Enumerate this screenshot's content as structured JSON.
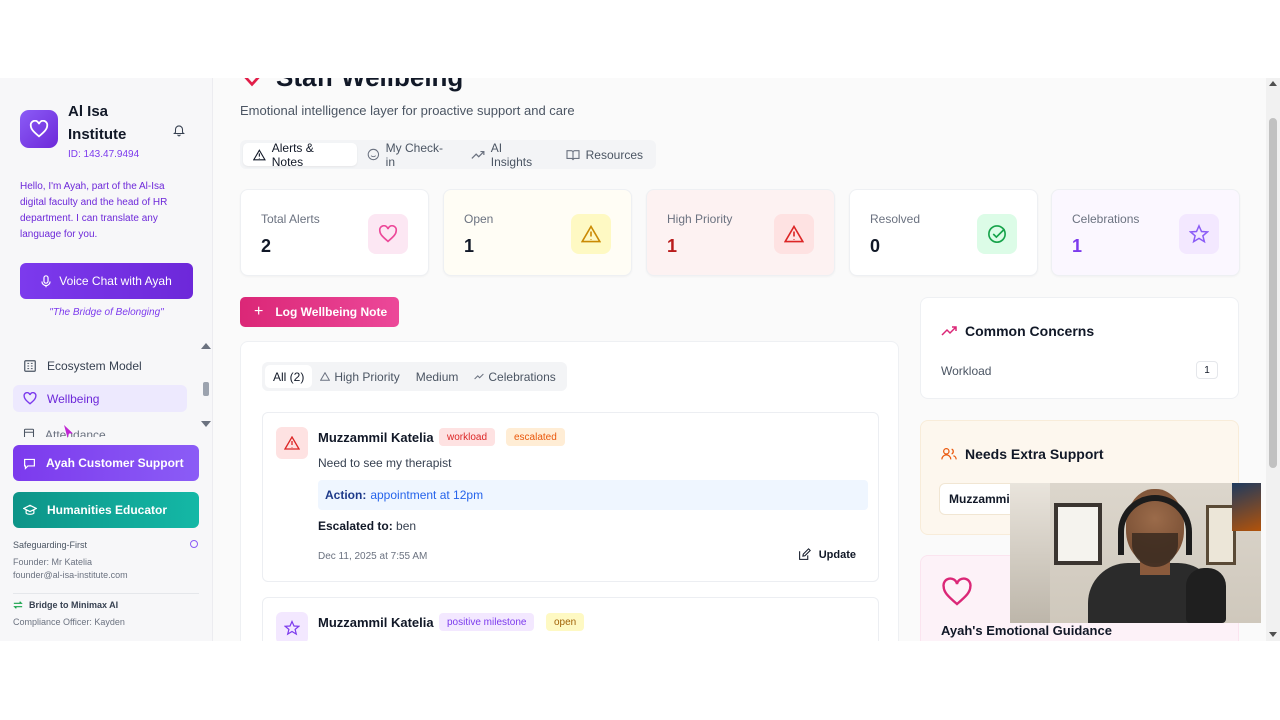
{
  "sidebar": {
    "brand_name": "Al Isa Institute",
    "brand_id": "ID: 143.47.9494",
    "intro": "Hello, I'm Ayah, part of the Al-Isa digital faculty and the head of HR department. I can translate any language for you.",
    "voice_button": "Voice Chat with Ayah",
    "tagline": "\"The Bridge of Belonging\"",
    "nav": [
      {
        "label": "Ecosystem Model",
        "icon": "building-icon"
      },
      {
        "label": "Wellbeing",
        "icon": "heart-icon"
      },
      {
        "label": "Attendance",
        "icon": "calendar-icon"
      }
    ],
    "support_button": "Ayah Customer Support",
    "educator_button": "Humanities Educator",
    "safeguarding": "Safeguarding-First",
    "founder": "Founder: Mr Katelia",
    "founder_email": "founder@al-isa-institute.com",
    "bridge": "Bridge to Minimax AI",
    "compliance": "Compliance Officer: Kayden"
  },
  "header": {
    "title": "Staff Wellbeing",
    "subtitle": "Emotional intelligence layer for proactive support and care"
  },
  "tabs": [
    {
      "label": "Alerts & Notes",
      "icon": "alert-triangle-icon",
      "active": true
    },
    {
      "label": "My Check-in",
      "icon": "smile-icon",
      "active": false
    },
    {
      "label": "AI Insights",
      "icon": "trend-up-icon",
      "active": false
    },
    {
      "label": "Resources",
      "icon": "book-icon",
      "active": false
    }
  ],
  "stats": [
    {
      "label": "Total Alerts",
      "value": "2",
      "color": "#111827",
      "tint": "#fce7f3",
      "accent": "#ec4899",
      "bg": "#ffffff",
      "icon": "heart-icon"
    },
    {
      "label": "Open",
      "value": "1",
      "color": "#111827",
      "tint": "#fef9c3",
      "accent": "#ca8a04",
      "bg": "#fffdf5",
      "icon": "alert-triangle-icon"
    },
    {
      "label": "High Priority",
      "value": "1",
      "color": "#b91c1c",
      "tint": "#fee2e2",
      "accent": "#dc2626",
      "bg": "#fdf2f2",
      "icon": "alert-triangle-icon"
    },
    {
      "label": "Resolved",
      "value": "0",
      "color": "#111827",
      "tint": "#dcfce7",
      "accent": "#16a34a",
      "bg": "#ffffff",
      "icon": "check-circle-icon"
    },
    {
      "label": "Celebrations",
      "value": "1",
      "color": "#7c3aed",
      "tint": "#f3e8ff",
      "accent": "#8b5cf6",
      "bg": "#fbf7ff",
      "icon": "star-icon"
    }
  ],
  "log_button": "Log Wellbeing Note",
  "filters": [
    {
      "label": "All (2)",
      "active": true,
      "icon": ""
    },
    {
      "label": "High Priority",
      "active": false,
      "icon": "alert-triangle-icon"
    },
    {
      "label": "Medium",
      "active": false,
      "icon": ""
    },
    {
      "label": "Celebrations",
      "active": false,
      "icon": "trend-up-icon"
    }
  ],
  "notes": [
    {
      "name": "Muzzammil Katelia",
      "badges": [
        "workload",
        "escalated"
      ],
      "text": "Need to see my therapist",
      "action_label": "Action:",
      "action_value": "appointment at 12pm",
      "escalated_label": "Escalated to:",
      "escalated_value": "ben",
      "timestamp": "Dec 11, 2025 at 7:55 AM",
      "update_label": "Update"
    },
    {
      "name": "Muzzammil Katelia",
      "badges": [
        "positive milestone",
        "open"
      ]
    }
  ],
  "right_panel": {
    "concerns_title": "Common Concerns",
    "concern_label": "Workload",
    "concern_count": "1",
    "support_title": "Needs Extra Support",
    "support_person": "Muzzammil",
    "guidance_title": "Ayah's Emotional Guidance"
  },
  "colors": {
    "accent": "#7c3aed",
    "pink": "#ec4899",
    "teal": "#14b8a6"
  }
}
